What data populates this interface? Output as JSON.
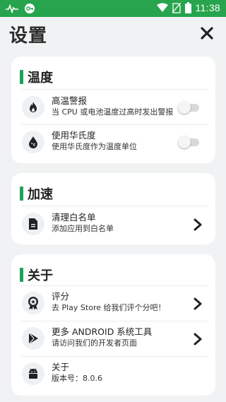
{
  "status_bar": {
    "time": "11:38",
    "icons": [
      "pulse-icon",
      "vpn-icon",
      "wifi-icon",
      "no-sim-icon",
      "battery-icon"
    ]
  },
  "header": {
    "title": "设置",
    "close_icon": "close-icon"
  },
  "colors": {
    "status_bar": "#27a44d",
    "accent": "#1aa35b",
    "background": "#f0f2f4",
    "card": "#ffffff"
  },
  "sections": {
    "temperature": {
      "title": "温度",
      "items": [
        {
          "icon": "flame-icon",
          "title": "高温警报",
          "subtitle": "当 CPU 或电池温度过高时发出警报",
          "control": "toggle",
          "enabled": false
        },
        {
          "icon": "fahrenheit-icon",
          "title": "使用华氏度",
          "subtitle": "使用华氏度作为温度单位",
          "control": "toggle",
          "enabled": false
        }
      ]
    },
    "boost": {
      "title": "加速",
      "items": [
        {
          "icon": "document-icon",
          "title": "清理白名单",
          "subtitle": "添加应用到白名单",
          "control": "chevron"
        }
      ]
    },
    "about": {
      "title": "关于",
      "items": [
        {
          "icon": "rating-badge-icon",
          "title": "评分",
          "subtitle": "去 Play Store 给我们评个分吧！",
          "control": "chevron"
        },
        {
          "icon": "play-store-icon",
          "title": "更多 ANDROID 系统工具",
          "subtitle": "请访问我们的开发者页面",
          "control": "chevron"
        },
        {
          "icon": "android-icon",
          "title": "关于",
          "subtitle": "版本号：8.0.6",
          "control": "none"
        }
      ]
    }
  }
}
